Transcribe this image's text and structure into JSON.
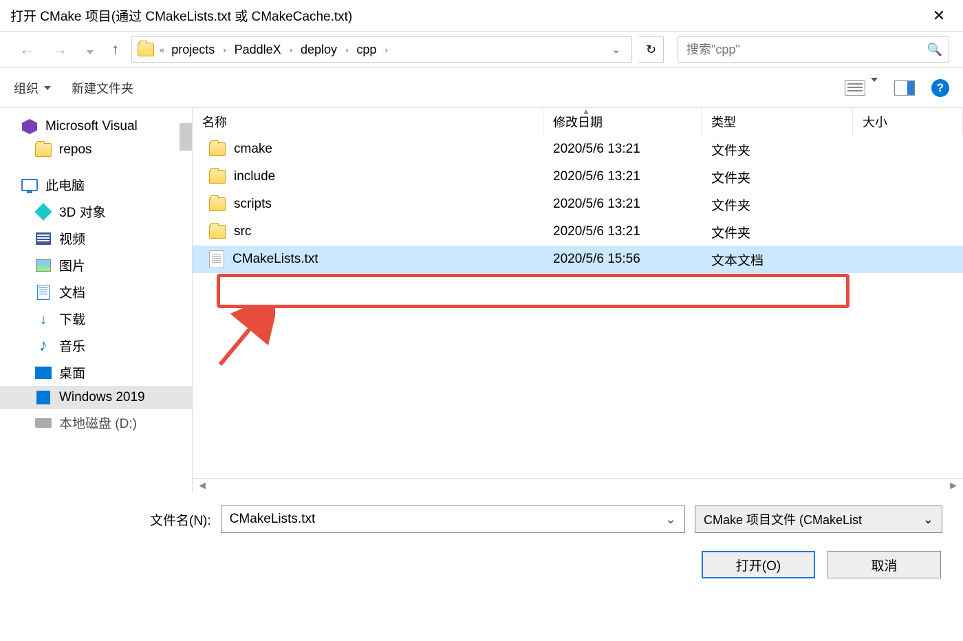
{
  "title": "打开 CMake 项目(通过 CMakeLists.txt 或 CMakeCache.txt)",
  "breadcrumb": {
    "prefix": "«",
    "segs": [
      "projects",
      "PaddleX",
      "deploy",
      "cpp"
    ]
  },
  "search": {
    "placeholder": "搜索\"cpp\""
  },
  "toolbar": {
    "organize": "组织",
    "newfolder": "新建文件夹"
  },
  "sidebar": {
    "vs": "Microsoft Visual",
    "repos": "repos",
    "pc": "此电脑",
    "d3d": "3D 对象",
    "video": "视频",
    "image": "图片",
    "doc": "文档",
    "download": "下载",
    "music": "音乐",
    "desktop": "桌面",
    "windows": "Windows 2019",
    "disk": "本地磁盘 (D:)"
  },
  "columns": {
    "name": "名称",
    "date": "修改日期",
    "type": "类型",
    "size": "大小"
  },
  "files": [
    {
      "name": "cmake",
      "date": "2020/5/6 13:21",
      "type": "文件夹",
      "kind": "folder"
    },
    {
      "name": "include",
      "date": "2020/5/6 13:21",
      "type": "文件夹",
      "kind": "folder"
    },
    {
      "name": "scripts",
      "date": "2020/5/6 13:21",
      "type": "文件夹",
      "kind": "folder"
    },
    {
      "name": "src",
      "date": "2020/5/6 13:21",
      "type": "文件夹",
      "kind": "folder"
    },
    {
      "name": "CMakeLists.txt",
      "date": "2020/5/6 15:56",
      "type": "文本文档",
      "kind": "file",
      "selected": true
    }
  ],
  "bottom": {
    "filename_label": "文件名(N):",
    "filename_value": "CMakeLists.txt",
    "filter": "CMake 项目文件  (CMakeList",
    "open": "打开(O)",
    "cancel": "取消"
  }
}
